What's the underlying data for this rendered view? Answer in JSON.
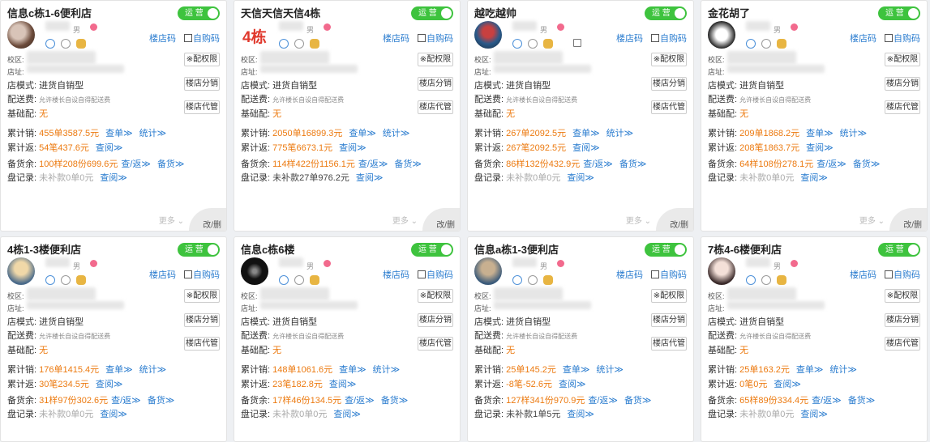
{
  "common": {
    "toggle": "运 营",
    "gender": "男",
    "qr_store": "楼店码",
    "qr_self": "自购码",
    "btn_perm": "※配权限",
    "btn_dist": "楼店分销",
    "btn_agent": "楼店代管",
    "lbl_campus": "校区:",
    "lbl_addr": "店址:",
    "lbl_mode": "店模式:",
    "mode_val": "进货自销型",
    "lbl_fee": "配送费:",
    "fee_val": "允许楼长自设自得配送费",
    "lbl_base": "基础配:",
    "base_val": "无",
    "lbl_sales": "累计销:",
    "lbl_return": "累计返:",
    "lbl_stock": "备货余:",
    "lbl_check": "盘记录:",
    "link_order": "查单≫",
    "link_stats": "统计≫",
    "link_query": "查阅≫",
    "link_check_return": "查/返≫",
    "link_restock": "备货≫",
    "more": "更多",
    "edit": "改/删"
  },
  "cards": [
    {
      "title": "信息c栋1-6便利店",
      "sales": "455单3587.5元",
      "ret": "54笔437.6元",
      "stock": "100样208份699.6元",
      "check": "未补款0单0元",
      "check_gray": true
    },
    {
      "title": "天信天信天信4栋",
      "bignum": "4栋",
      "sales": "2050单16899.3元",
      "ret": "775笔6673.1元",
      "stock": "114样422份1156.1元",
      "check": "未补款27单976.2元",
      "check_gray": false
    },
    {
      "title": "越吃越帅",
      "sales": "267单2092.5元",
      "ret": "267笔2092.5元",
      "stock": "86样132份432.9元",
      "check": "未补款0单0元",
      "check_gray": true
    },
    {
      "title": "金花胡了",
      "sales": "209单1868.2元",
      "ret": "208笔1863.7元",
      "stock": "64样108份278.1元",
      "check": "未补款0单0元",
      "check_gray": true
    },
    {
      "title": "4栋1-3楼便利店",
      "sales": "176单1415.4元",
      "ret": "30笔234.5元",
      "stock": "31样97份302.6元",
      "check": "未补款0单0元",
      "check_gray": true
    },
    {
      "title": "信息c栋6楼",
      "sales": "148单1061.6元",
      "ret": "23笔182.8元",
      "stock": "17样46份134.5元",
      "check": "未补款0单0元",
      "check_gray": true
    },
    {
      "title": "信息a栋1-3便利店",
      "sales": "25单145.2元",
      "ret": "-8笔-52.6元",
      "stock": "127样341份970.9元",
      "check": "未补款1单5元",
      "check_gray": false
    },
    {
      "title": "7栋4-6楼便利店",
      "sales": "25单163.2元",
      "ret": "0笔0元",
      "stock": "65样89份334.4元",
      "check": "未补款0单0元",
      "check_gray": true
    }
  ],
  "colors": {
    "toggle": "#3ec33e",
    "amount": "#ec7a10",
    "link": "#2a7ccf",
    "bignum": "#e0382c"
  }
}
